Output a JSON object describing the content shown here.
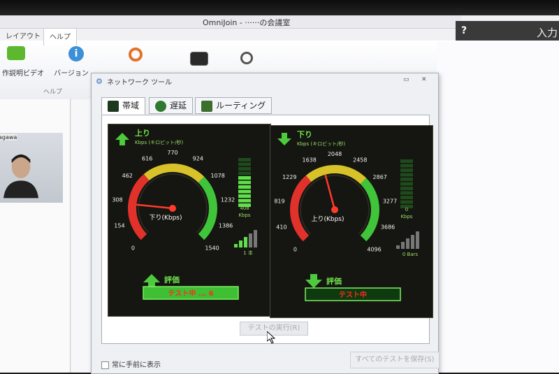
{
  "window": {
    "title": "OmniJoin - ······の会議室"
  },
  "ribbon": {
    "tabs": [
      "レイアウト",
      "ヘルプ"
    ],
    "buttons": [
      {
        "label": "作説明ビデオ"
      },
      {
        "label": "バージョン"
      }
    ],
    "group_label": "ヘルプ"
  },
  "top_right": {
    "label": "入力"
  },
  "video": {
    "name_tag": "agawa"
  },
  "dialog": {
    "title": "ネットワーク ツール",
    "min_label": "▭",
    "close_label": "✕",
    "tabs": [
      {
        "label": "帯域",
        "active": true
      },
      {
        "label": "遅延",
        "active": false
      },
      {
        "label": "ルーティング",
        "active": false
      }
    ],
    "run_button": "テストの実行(R)",
    "always_on_top": "常に手前に表示",
    "save_all_button": "すべてのテストを保存(S)"
  },
  "gauges": [
    {
      "title": "上り",
      "unit_label": "Kbps (キロビット/秒)",
      "needle_label": "下り(Kbps)",
      "ticks": [
        "0",
        "154",
        "308",
        "462",
        "616",
        "770",
        "924",
        "1078",
        "1232",
        "1386",
        "1540"
      ],
      "max": 1540,
      "needle_value": 290,
      "meter_value": "408",
      "meter_unit": "Kbps",
      "meter_fill": 0.6,
      "bars_label": "1 本",
      "bars_fill": 0.6,
      "eval_label": "評価",
      "eval_status": "テスト中 ... 6",
      "direction": "up"
    },
    {
      "title": "下り",
      "unit_label": "Kbps (キロビット/秒)",
      "needle_label": "上り(Kbps)",
      "ticks": [
        "0",
        "410",
        "819",
        "1229",
        "1638",
        "2048",
        "2458",
        "2867",
        "3277",
        "3686",
        "4096"
      ],
      "max": 4096,
      "needle_value": 1820,
      "meter_value": "0",
      "meter_unit": "Kbps",
      "meter_fill": 0.0,
      "bars_label": "0 Bars",
      "bars_fill": 0.0,
      "eval_label": "評価",
      "eval_status": "テスト中",
      "direction": "down"
    }
  ],
  "colors": {
    "gauge_bg": "#151511",
    "green": "#3fc43a",
    "red": "#e0322a",
    "yellow": "#d8c22a"
  }
}
